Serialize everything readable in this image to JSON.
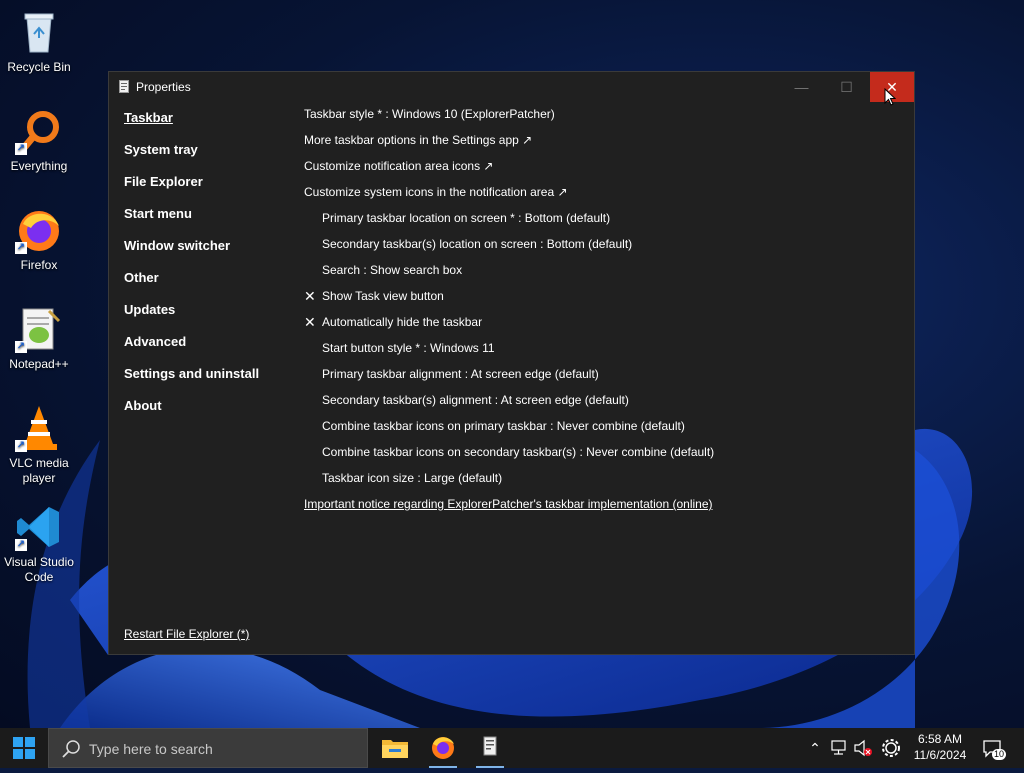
{
  "desktop": {
    "icons": [
      {
        "label": "Recycle Bin",
        "icon": "recycle-bin-icon"
      },
      {
        "label": "Everything",
        "icon": "everything-icon"
      },
      {
        "label": "Firefox",
        "icon": "firefox-icon"
      },
      {
        "label": "Notepad++",
        "icon": "notepad-plus-plus-icon"
      },
      {
        "label": "VLC media player",
        "icon": "vlc-icon"
      },
      {
        "label": "Visual Studio Code",
        "icon": "vscode-icon"
      }
    ]
  },
  "window": {
    "title": "Properties",
    "minimize_glyph": "—",
    "maximize_glyph": "☐",
    "close_glyph": "✕",
    "nav": [
      {
        "label": "Taskbar",
        "active": true
      },
      {
        "label": "System tray"
      },
      {
        "label": "File Explorer"
      },
      {
        "label": "Start menu"
      },
      {
        "label": "Window switcher"
      },
      {
        "label": "Other"
      },
      {
        "label": "Updates"
      },
      {
        "label": "Advanced"
      },
      {
        "label": "Settings and uninstall"
      },
      {
        "label": "About"
      }
    ],
    "restart_label": "Restart File Explorer (*)",
    "options": [
      {
        "label": "Taskbar style * : Windows 10 (ExplorerPatcher)"
      },
      {
        "label": "More taskbar options in the Settings app ↗"
      },
      {
        "label": "Customize notification area icons ↗"
      },
      {
        "label": "Customize system icons in the notification area ↗"
      },
      {
        "label": "Primary taskbar location on screen * : Bottom (default)"
      },
      {
        "label": "Secondary taskbar(s) location on screen : Bottom (default)"
      },
      {
        "label": "Search : Show search box"
      },
      {
        "label": "Show Task view button",
        "checked": true
      },
      {
        "label": "Automatically hide the taskbar",
        "checked": true
      },
      {
        "label": "Start button style * : Windows 11"
      },
      {
        "label": "Primary taskbar alignment : At screen edge (default)"
      },
      {
        "label": "Secondary taskbar(s) alignment : At screen edge (default)"
      },
      {
        "label": "Combine taskbar icons on primary taskbar : Never combine (default)"
      },
      {
        "label": "Combine taskbar icons on secondary taskbar(s) : Never combine (default)"
      },
      {
        "label": "Taskbar icon size : Large (default)"
      },
      {
        "label": "Important notice regarding ExplorerPatcher's taskbar implementation (online)"
      }
    ],
    "check_glyph": "✕"
  },
  "taskbar": {
    "search_placeholder": "Type here to search",
    "apps": [
      "file-explorer-icon",
      "firefox-icon",
      "properties-app-icon"
    ],
    "tray": {
      "chevron_glyph": "⌃",
      "time": "6:58 AM",
      "date": "11/6/2024",
      "notification_count": "10"
    }
  },
  "colors": {
    "close_button": "#c42b1c",
    "window_bg": "#202020",
    "taskbar_bg": "#1b1b1b",
    "active_app_underline": "#7fb4e8"
  }
}
